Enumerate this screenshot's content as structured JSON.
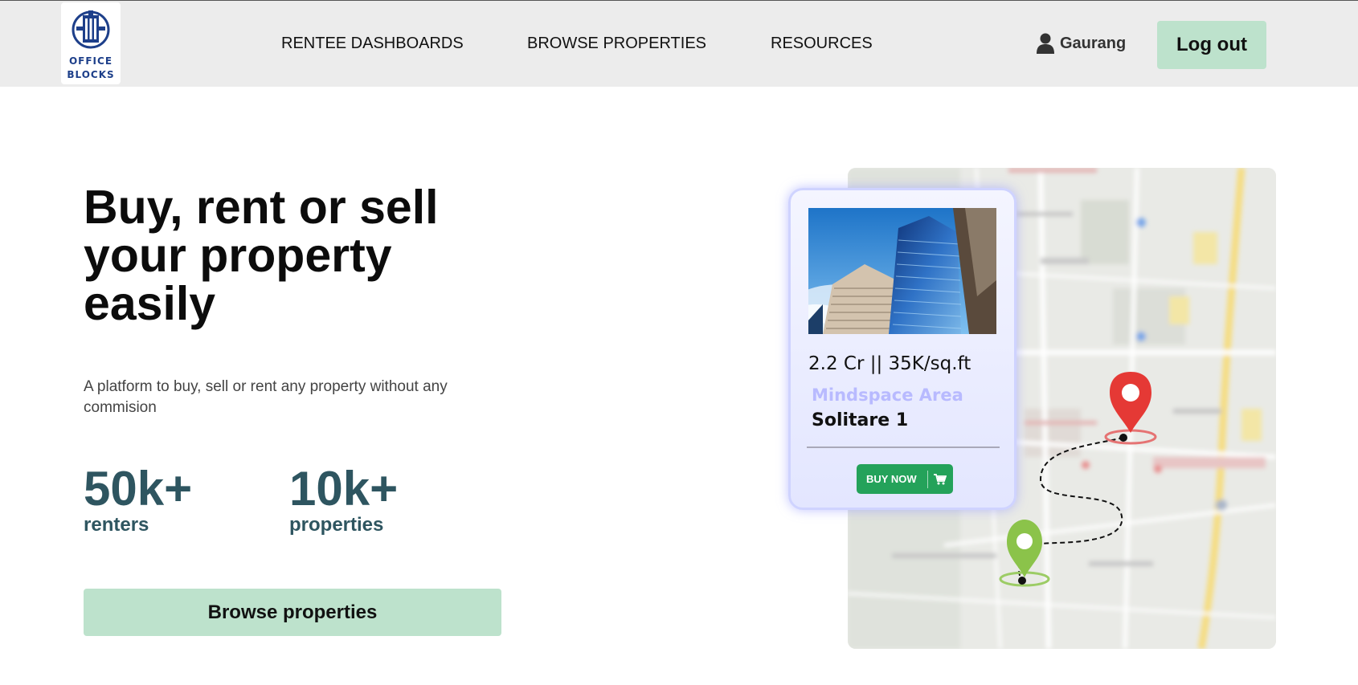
{
  "brand": {
    "line1": "OFFICE",
    "line2": "BLOCKS"
  },
  "nav": {
    "items": [
      "RENTEE DASHBOARDS",
      "BROWSE PROPERTIES",
      "RESOURCES"
    ]
  },
  "user": {
    "name": "Gaurang",
    "icon": "user-icon"
  },
  "header": {
    "logout_label": "Log out"
  },
  "hero": {
    "title_line1": "Buy, rent or sell",
    "title_line2": "your property",
    "title_line3": "easily",
    "subtitle": "A platform to buy, sell or rent any property without any commision",
    "stats": [
      {
        "value": "50k+",
        "label": "renters"
      },
      {
        "value": "10k+",
        "label": "properties"
      }
    ],
    "cta_label": "Browse properties"
  },
  "property_card": {
    "price": "2.2 Cr || 35K/sq.ft",
    "area": "Mindspace Area",
    "name": "Solitare 1",
    "buy_label": "BUY NOW",
    "cart_icon": "cart-icon"
  },
  "map": {
    "pins": [
      "destination-pin-icon",
      "origin-pin-icon"
    ]
  },
  "colors": {
    "accent_green": "#bde2cc",
    "stat_color": "#2e5560",
    "pin_red": "#e53935",
    "pin_green": "#8bc34a",
    "buy_green": "#24a25a"
  }
}
